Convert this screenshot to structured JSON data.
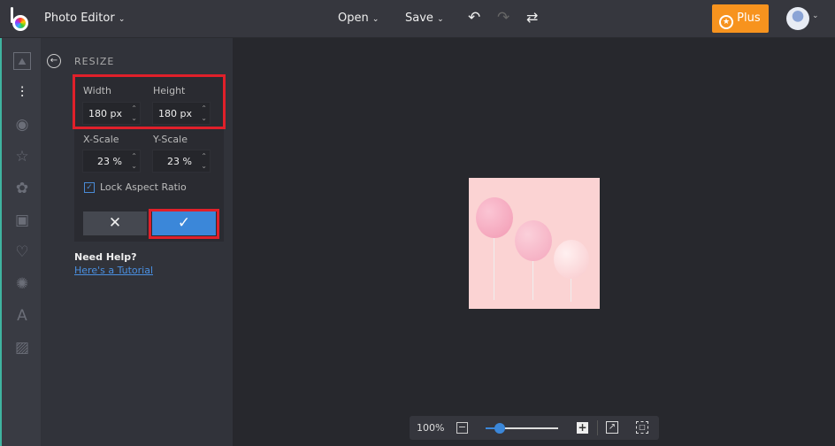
{
  "header": {
    "app_title": "Photo Editor",
    "open_label": "Open",
    "save_label": "Save",
    "plus_label": "Plus"
  },
  "sidebar": {
    "icons": [
      "image-icon",
      "adjustments-icon",
      "eye-icon",
      "star-icon",
      "shapes-icon",
      "frame-icon",
      "heart-icon",
      "badge-icon",
      "text-icon",
      "texture-icon"
    ]
  },
  "panel": {
    "title": "RESIZE",
    "width_label": "Width",
    "height_label": "Height",
    "width_value": "180 px",
    "height_value": "180 px",
    "xscale_label": "X-Scale",
    "yscale_label": "Y-Scale",
    "xscale_value": "23 %",
    "yscale_value": "23 %",
    "lock_label": "Lock Aspect Ratio",
    "lock_checked": true,
    "help_title": "Need Help?",
    "help_link": "Here's a Tutorial"
  },
  "zoom": {
    "label": "100%",
    "slider_fraction": 0.2
  },
  "colors": {
    "accent": "#3b87d9",
    "plus": "#f7931e",
    "highlight": "#e0202a"
  }
}
